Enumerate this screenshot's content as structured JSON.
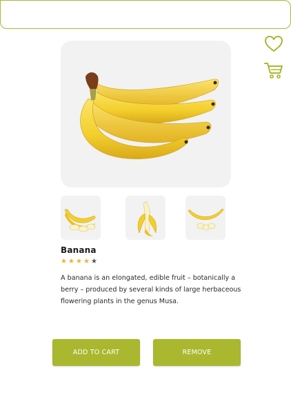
{
  "theme": {
    "accent": "#a9b82e",
    "star_color": "#e8b430",
    "image_bg": "#f2f2f2"
  },
  "header": {
    "icons": {
      "wishlist": "heart-icon",
      "cart": "cart-icon"
    }
  },
  "product": {
    "name": "Banana",
    "rating": {
      "value": 4,
      "max": 5,
      "stars": [
        "★",
        "★",
        "★",
        "★",
        "★"
      ]
    },
    "description": "A banana is an elongated, edible fruit – botanically a berry – produced by several kinds of large herbaceous flowering plants in the genus Musa."
  },
  "gallery": {
    "thumbnails": [
      "banana-slices",
      "peeled-banana",
      "banana-with-slices"
    ]
  },
  "actions": {
    "add_to_cart": "ADD TO CART",
    "remove": "REMOVE"
  }
}
